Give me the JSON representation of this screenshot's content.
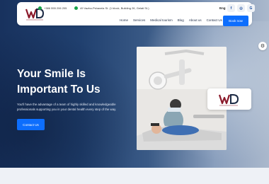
{
  "header": {
    "phone": "+386 555 206 205",
    "address": "49 Vazha-Pshavela St. (1 block, Building 26, Gelati St.)",
    "nav": [
      "Home",
      "Services",
      "Medical tourism",
      "Blog",
      "About us",
      "Contact Us"
    ],
    "language": "Eng",
    "book_label": "Book now",
    "social_icons": [
      "facebook-icon",
      "instagram-icon",
      "google-plus-icon"
    ]
  },
  "hero": {
    "headline_line1": "Your Smile Is",
    "headline_line2": "Important To Us",
    "description": "You'll have the advantage of a team of highly skilled and knowledgeable professionals supporting you in your dental health every step of the way.",
    "contact_label": "Contact Us"
  },
  "colors": {
    "accent": "#0d6efd",
    "brand": "#8b1a2b",
    "hero_dark": "#18325e"
  }
}
